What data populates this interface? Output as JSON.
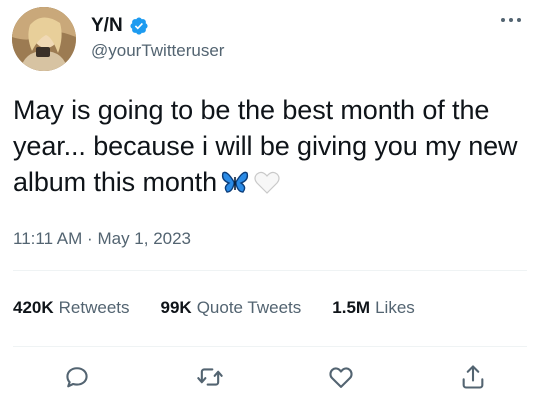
{
  "author": {
    "display_name": "Y/N",
    "handle": "@yourTwitteruser",
    "verified": true,
    "avatar_icon": "profile-photo"
  },
  "tweet": {
    "text": "May is going to be the best month of the year... because i will be giving you my new album this month",
    "emojis": [
      "blue-butterfly-emoji",
      "white-heart-emoji"
    ],
    "time": "11:11 AM",
    "separator": "·",
    "date": "May 1, 2023"
  },
  "stats": {
    "retweets": {
      "count": "420K",
      "label": "Retweets"
    },
    "quote_tweets": {
      "count": "99K",
      "label": "Quote Tweets"
    },
    "likes": {
      "count": "1.5M",
      "label": "Likes"
    }
  },
  "actions": [
    "reply-icon",
    "retweet-icon",
    "like-icon",
    "share-icon"
  ],
  "colors": {
    "text": "#0f1419",
    "secondary": "#536471",
    "verified": "#1d9bf0",
    "divider": "#eff3f4"
  }
}
